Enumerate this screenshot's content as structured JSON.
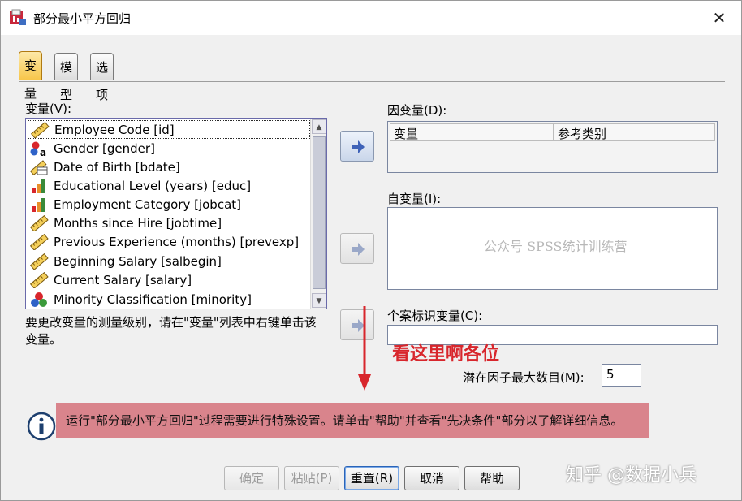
{
  "window": {
    "title": "部分最小平方回归",
    "close_symbol": "✕"
  },
  "tabs": [
    {
      "label": "变量",
      "active": true
    },
    {
      "label": "模型",
      "active": false
    },
    {
      "label": "选项",
      "active": false
    }
  ],
  "variables": {
    "label": "变量(V):",
    "items": [
      {
        "label": "Employee Code [id]",
        "icon": "scale-ruler-icon"
      },
      {
        "label": "Gender [gender]",
        "icon": "nominal-string-icon"
      },
      {
        "label": "Date of Birth [bdate]",
        "icon": "date-scale-icon"
      },
      {
        "label": "Educational Level (years) [educ]",
        "icon": "ordinal-bars-icon"
      },
      {
        "label": "Employment Category [jobcat]",
        "icon": "ordinal-bars-icon"
      },
      {
        "label": "Months since Hire [jobtime]",
        "icon": "scale-ruler-icon"
      },
      {
        "label": "Previous Experience (months) [prevexp]",
        "icon": "scale-ruler-icon"
      },
      {
        "label": "Beginning Salary [salbegin]",
        "icon": "scale-ruler-icon"
      },
      {
        "label": "Current Salary [salary]",
        "icon": "scale-ruler-icon"
      },
      {
        "label": "Minority Classification [minority]",
        "icon": "nominal-circles-icon"
      }
    ],
    "hint_line1": "要更改变量的测量级别，请在\"变量\"列表中右键单击该",
    "hint_line2": "变量。"
  },
  "dependent": {
    "label": "因变量(D):",
    "col_variable": "变量",
    "col_reference": "参考类别"
  },
  "independent": {
    "label": "自变量(I):"
  },
  "case_id": {
    "label": "个案标识变量(C):"
  },
  "factors": {
    "label": "潜在因子最大数目(M):",
    "value": "5"
  },
  "watermark": "公众号 SPSS统计训练营",
  "annotation": "看这里啊各位",
  "info_message": "运行\"部分最小平方回归\"过程需要进行特殊设置。请单击\"帮助\"并查看\"先决条件\"部分以了解详细信息。",
  "buttons": {
    "ok": "确定",
    "paste": "粘贴(P)",
    "reset": "重置(R)",
    "cancel": "取消",
    "help": "帮助"
  },
  "brand_watermark": "知乎 @数据小兵",
  "colors": {
    "info_bar": "#d9848c",
    "annotation_red": "#d8262c",
    "active_tab": "#f7c548"
  }
}
